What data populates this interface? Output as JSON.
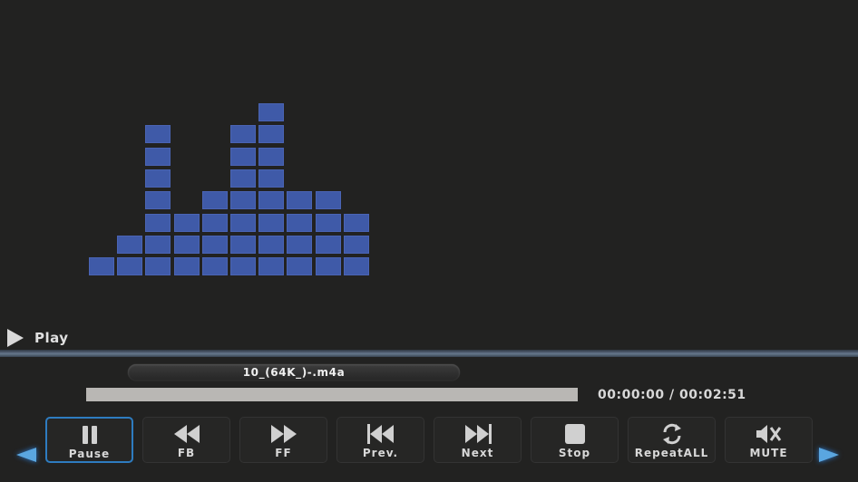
{
  "visualizer": {
    "levels": [
      1,
      2,
      7,
      3,
      4,
      7,
      8,
      4,
      4,
      3
    ],
    "max_level": 8,
    "color": "#3f5aa8"
  },
  "status": {
    "label": "Play",
    "icon": "play-icon"
  },
  "track": {
    "filename": "10_(64K_)-.m4a"
  },
  "progress": {
    "fraction": 0.0,
    "time_display": "00:00:00 / 00:02:51",
    "elapsed": "00:00:00",
    "total": "00:02:51"
  },
  "controls": [
    {
      "label": "Pause",
      "icon": "pause-icon",
      "active": true
    },
    {
      "label": "FB",
      "icon": "fast-backward-icon",
      "active": false
    },
    {
      "label": "FF",
      "icon": "fast-forward-icon",
      "active": false
    },
    {
      "label": "Prev.",
      "icon": "previous-track-icon",
      "active": false
    },
    {
      "label": "Next",
      "icon": "next-track-icon",
      "active": false
    },
    {
      "label": "Stop",
      "icon": "stop-icon",
      "active": false
    },
    {
      "label": "RepeatALL",
      "icon": "repeat-icon",
      "active": false
    },
    {
      "label": "MUTE",
      "icon": "mute-icon",
      "active": false
    }
  ],
  "colors": {
    "accent": "#2e7cc0",
    "background": "#222221",
    "progress_track": "#b9b7b4"
  }
}
